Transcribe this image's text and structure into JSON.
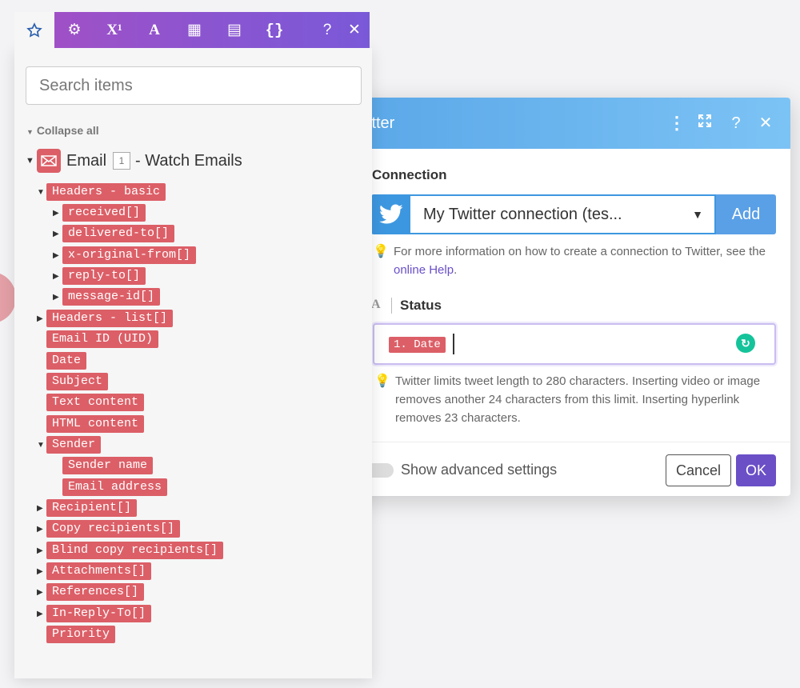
{
  "dialog": {
    "title": "itter",
    "connection_label": "Connection",
    "connection_value": "My Twitter connection (tes...",
    "add_label": "Add",
    "hint_connection_prefix": "For more information on how to create a connection to Twitter, see the ",
    "hint_connection_link": "online Help",
    "hint_connection_suffix": ".",
    "status_type": "A",
    "status_label": "Status",
    "status_token": "1. Date",
    "hint_status": "Twitter limits tweet length to 280 characters. Inserting video or image removes another 24 characters from this limit. Inserting hyperlink removes 23 characters.",
    "advanced_label": "Show advanced settings",
    "cancel_label": "Cancel",
    "ok_label": "OK",
    "colors": {
      "accent": "#6a4fc7",
      "header": "#5aa7e8",
      "twitter": "#3d97e0"
    }
  },
  "panel": {
    "tabs": [
      {
        "icon": "star-icon",
        "glyph": "☆"
      },
      {
        "icon": "gear-icon",
        "glyph": "⚙"
      },
      {
        "icon": "superscript-icon",
        "glyph": "X¹"
      },
      {
        "icon": "text-icon",
        "glyph": "A"
      },
      {
        "icon": "calendar-icon",
        "glyph": "▦"
      },
      {
        "icon": "table-icon",
        "glyph": "▤"
      },
      {
        "icon": "braces-icon",
        "glyph": "{}"
      }
    ],
    "help_glyph": "?",
    "close_glyph": "✕",
    "search_placeholder": "Search items",
    "collapse_label": "Collapse all",
    "root": {
      "name": "Email",
      "badge": "1",
      "suffix": "- Watch Emails"
    },
    "items": [
      {
        "label": "Headers - basic",
        "caret": "▼"
      },
      {
        "label": "received[]",
        "caret": "▶"
      },
      {
        "label": "delivered-to[]",
        "caret": "▶"
      },
      {
        "label": "x-original-from[]",
        "caret": "▶"
      },
      {
        "label": "reply-to[]",
        "caret": "▶"
      },
      {
        "label": "message-id[]",
        "caret": "▶"
      },
      {
        "label": "Headers - list[]",
        "caret": "▶"
      },
      {
        "label": "Email ID (UID)",
        "caret": ""
      },
      {
        "label": "Date",
        "caret": ""
      },
      {
        "label": "Subject",
        "caret": ""
      },
      {
        "label": "Text content",
        "caret": ""
      },
      {
        "label": "HTML content",
        "caret": ""
      },
      {
        "label": "Sender",
        "caret": "▼"
      },
      {
        "label": "Sender name",
        "caret": ""
      },
      {
        "label": "Email address",
        "caret": ""
      },
      {
        "label": "Recipient[]",
        "caret": "▶"
      },
      {
        "label": "Copy recipients[]",
        "caret": "▶"
      },
      {
        "label": "Blind copy recipients[]",
        "caret": "▶"
      },
      {
        "label": "Attachments[]",
        "caret": "▶"
      },
      {
        "label": "References[]",
        "caret": "▶"
      },
      {
        "label": "In-Reply-To[]",
        "caret": "▶"
      },
      {
        "label": "Priority",
        "caret": ""
      }
    ]
  }
}
